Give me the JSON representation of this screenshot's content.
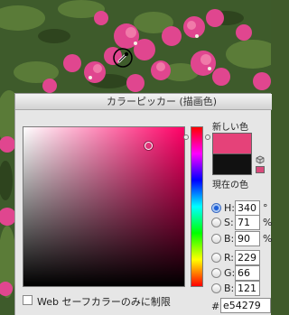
{
  "dialog": {
    "title": "カラーピッカー (描画色)",
    "new_label": "新しい色",
    "current_label": "現在の色",
    "new_color": "#e54279",
    "current_color": "#111111",
    "web_only_label": "Web セーフカラーのみに制限"
  },
  "fields": {
    "h": {
      "label": "H:",
      "value": "340",
      "unit": "°"
    },
    "s": {
      "label": "S:",
      "value": "71",
      "unit": "%"
    },
    "b": {
      "label": "B:",
      "value": "90",
      "unit": "%"
    },
    "r": {
      "label": "R:",
      "value": "229"
    },
    "g": {
      "label": "G:",
      "value": "66"
    },
    "bb": {
      "label": "B:",
      "value": "121"
    },
    "hex": {
      "label": "#",
      "value": "e54279"
    }
  },
  "icons": {
    "cursor": "eyedropper-icon",
    "websafe": "cube-icon"
  }
}
